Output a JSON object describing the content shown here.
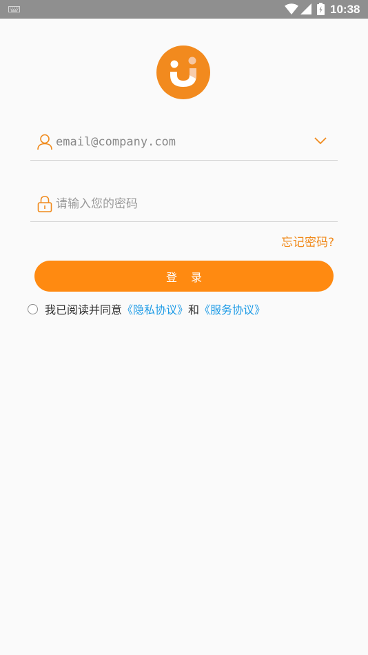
{
  "status_bar": {
    "time": "10:38",
    "icons": [
      "keyboard-icon",
      "wifi-icon",
      "signal-icon",
      "battery-icon"
    ]
  },
  "logo": {
    "icon": "app-logo-icon",
    "color": "#f28a1e"
  },
  "email_field": {
    "value": "email@company.com",
    "icon": "user-icon"
  },
  "password_field": {
    "placeholder": "请输入您的密码",
    "icon": "lock-icon"
  },
  "forgot_link": "忘记密码?",
  "login_button": "登录",
  "agreement": {
    "prefix": "我已阅读并同意",
    "privacy_link": "《隐私协议》",
    "connector": "和",
    "service_link": "《服务协议》",
    "checked": false
  },
  "colors": {
    "accent": "#ff8a11",
    "link": "#1e9be6",
    "status_bar": "#8f8f8f"
  }
}
